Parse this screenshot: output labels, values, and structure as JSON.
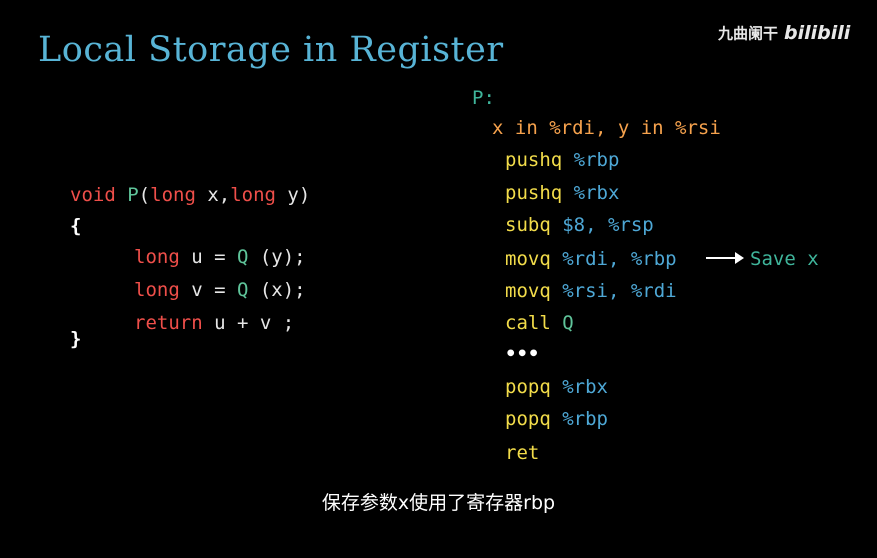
{
  "title": "Local Storage in Register",
  "watermark": {
    "text": "九曲阑干",
    "logo": "bilibili"
  },
  "c_code": {
    "kw_void": "void",
    "fn_P": "P",
    "paren_open": "(",
    "kw_long1": "long",
    "param_x": " x,",
    "kw_long2": "long",
    "param_y": " y)",
    "brace_open": "{",
    "kw_long_u": "long",
    "u_assign": " u = ",
    "call_Q1": "Q",
    "arg_y": " (y);",
    "kw_long_v": "long",
    "v_assign": " v = ",
    "call_Q2": "Q",
    "arg_x": " (x);",
    "kw_return": "return",
    "ret_expr": " u + v ;",
    "brace_close": "}"
  },
  "asm": {
    "label": "P:",
    "comment": "x in %rdi, y in %rsi",
    "lines": [
      {
        "op": "pushq",
        "args": " %rbp"
      },
      {
        "op": "pushq",
        "args": " %rbx"
      },
      {
        "op": "subq",
        "args": " $8, %rsp"
      },
      {
        "op": "movq",
        "args": " %rdi, %rbp"
      },
      {
        "op": "movq",
        "args": " %rsi, %rdi"
      },
      {
        "op": "call",
        "args": " Q"
      },
      {
        "op": "•••",
        "args": ""
      },
      {
        "op": "popq",
        "args": " %rbx"
      },
      {
        "op": "popq",
        "args": " %rbp"
      },
      {
        "op": "ret",
        "args": ""
      }
    ],
    "annotation": "Save x"
  },
  "subtitle": "保存参数x使用了寄存器rbp",
  "colors": {
    "background": "#000000",
    "title": "#58b4d6",
    "keyword": "#ef4f4a",
    "function": "#5fc49a",
    "op": "#f2dc4a",
    "register": "#4ea8d6",
    "comment": "#f6a24d",
    "annotation": "#3fb59b"
  }
}
